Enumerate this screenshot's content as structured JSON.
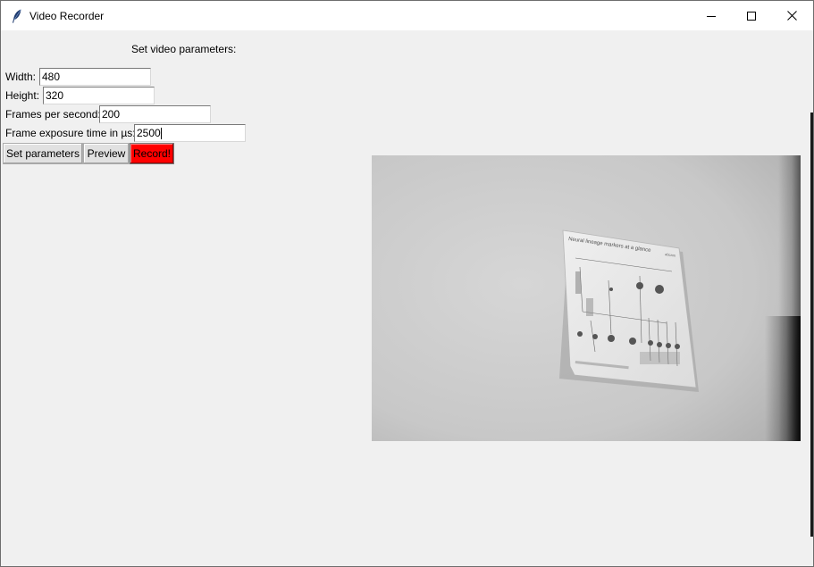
{
  "window": {
    "title": "Video Recorder",
    "controls": {
      "minimize_icon": "minimize-icon",
      "maximize_icon": "maximize-icon",
      "close_icon": "close-icon"
    }
  },
  "form": {
    "heading": "Set video parameters:",
    "fields": [
      {
        "label": "Width:",
        "value": "480"
      },
      {
        "label": "Height:",
        "value": "320"
      },
      {
        "label": "Frames per second:",
        "value": "200"
      },
      {
        "label": "Frame exposure time in µs:",
        "value": "2500"
      }
    ]
  },
  "buttons": {
    "set_parameters": "Set parameters",
    "preview": "Preview",
    "record": "Record!"
  },
  "colors": {
    "record_button": "#ff0000",
    "window_bg": "#f0f0f0",
    "titlebar_bg": "#ffffff"
  },
  "preview_image": {
    "poster_title": "Neural lineage markers at a glance",
    "poster_brand": "abcam"
  }
}
